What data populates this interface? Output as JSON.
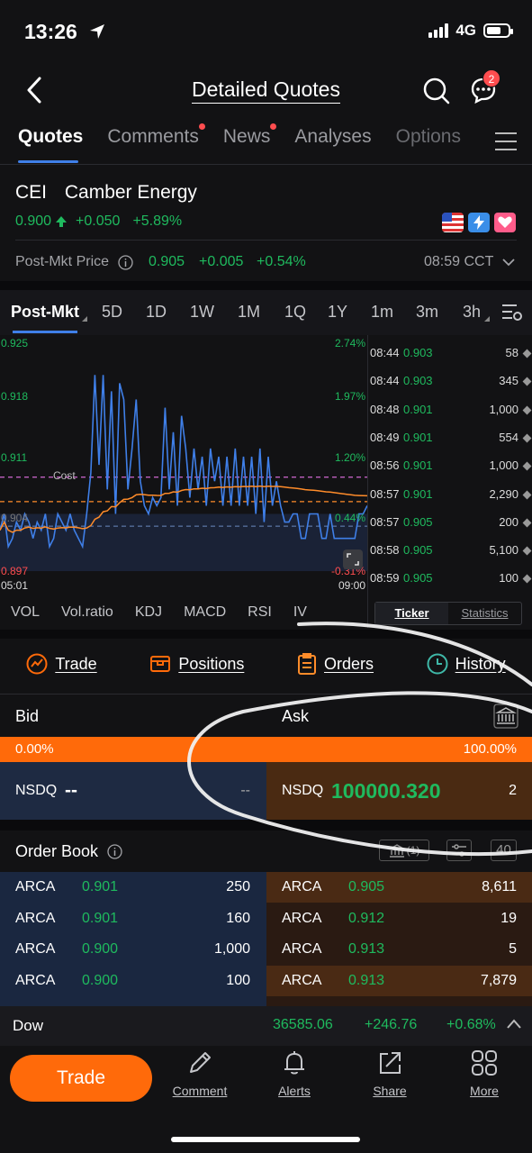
{
  "status_bar": {
    "time": "13:26",
    "network": "4G"
  },
  "header": {
    "title": "Detailed Quotes",
    "badge_count": "2"
  },
  "tabs": [
    {
      "label": "Quotes",
      "active": true,
      "dot": false
    },
    {
      "label": "Comments",
      "active": false,
      "dot": true
    },
    {
      "label": "News",
      "active": false,
      "dot": true
    },
    {
      "label": "Analyses",
      "active": false,
      "dot": false
    },
    {
      "label": "Options",
      "active": false,
      "dot": false
    }
  ],
  "stock": {
    "symbol": "CEI",
    "name": "Camber Energy",
    "price": "0.900",
    "change": "+0.050",
    "change_pct": "+5.89%"
  },
  "post_market": {
    "label": "Post-Mkt Price",
    "price": "0.905",
    "change": "+0.005",
    "change_pct": "+0.54%",
    "time": "08:59 CCT"
  },
  "range_tabs": [
    "Post-Mkt",
    "5D",
    "1D",
    "1W",
    "1M",
    "1Q",
    "1Y",
    "1m",
    "3m",
    "3h"
  ],
  "chart": {
    "y_left": [
      "0.925",
      "0.918",
      "0.911",
      "0.904",
      "0.897"
    ],
    "y_right": [
      "2.74%",
      "1.97%",
      "1.20%",
      "0.44%",
      "-0.31%"
    ],
    "x_start": "05:01",
    "x_end": "09:00",
    "cost_label": "Cost"
  },
  "chart_data": {
    "type": "line",
    "ylim": [
      0.897,
      0.925
    ],
    "xlim": [
      "05:01",
      "09:00"
    ],
    "series": [
      {
        "values": [
          0.902,
          0.904,
          0.9,
          0.901,
          0.903,
          0.902,
          0.904,
          0.903,
          0.901,
          0.903,
          0.902,
          0.904,
          0.9,
          0.901,
          0.904,
          0.903,
          0.902,
          0.904,
          0.902,
          0.901,
          0.9,
          0.904,
          0.909,
          0.921,
          0.91,
          0.921,
          0.907,
          0.919,
          0.904,
          0.92,
          0.918,
          0.907,
          0.912,
          0.918,
          0.908,
          0.905,
          0.904,
          0.906,
          0.905,
          0.906,
          0.917,
          0.907,
          0.914,
          0.905,
          0.916,
          0.912,
          0.906,
          0.912,
          0.907,
          0.911,
          0.905,
          0.912,
          0.908,
          0.911,
          0.905,
          0.911,
          0.905,
          0.912,
          0.905,
          0.911,
          0.905,
          0.911,
          0.904,
          0.912,
          0.903,
          0.911,
          0.905,
          0.908,
          0.905,
          0.903,
          0.903,
          0.904,
          0.904,
          0.901,
          0.901,
          0.904,
          0.904,
          0.904,
          0.901,
          0.901,
          0.904,
          0.901,
          0.901,
          0.901,
          0.901,
          0.901,
          0.901,
          0.904,
          0.904,
          0.905
        ]
      }
    ]
  },
  "ticker": [
    {
      "time": "08:44",
      "price": "0.903",
      "vol": "58"
    },
    {
      "time": "08:44",
      "price": "0.903",
      "vol": "345"
    },
    {
      "time": "08:48",
      "price": "0.901",
      "vol": "1,000"
    },
    {
      "time": "08:49",
      "price": "0.901",
      "vol": "554"
    },
    {
      "time": "08:56",
      "price": "0.901",
      "vol": "1,000"
    },
    {
      "time": "08:57",
      "price": "0.901",
      "vol": "2,290"
    },
    {
      "time": "08:57",
      "price": "0.905",
      "vol": "200"
    },
    {
      "time": "08:58",
      "price": "0.905",
      "vol": "5,100"
    },
    {
      "time": "08:59",
      "price": "0.905",
      "vol": "100"
    }
  ],
  "ticker_tabs": [
    "Ticker",
    "Statistics"
  ],
  "indicator_tabs": [
    "VOL",
    "Vol.ratio",
    "KDJ",
    "MACD",
    "RSI",
    "IV"
  ],
  "trade_row": [
    "Trade",
    "Positions",
    "Orders",
    "History"
  ],
  "bid_ask": {
    "bid_label": "Bid",
    "ask_label": "Ask",
    "bid_pct": "0.00%",
    "ask_pct": "100.00%",
    "bid_fraction": 0.0,
    "bid_exchange": "NSDQ",
    "bid_price": "--",
    "bid_size": "--",
    "ask_exchange": "NSDQ",
    "ask_price": "100000.320",
    "ask_size": "2"
  },
  "order_book": {
    "title": "Order Book",
    "exchange_count": "(1)",
    "depth": "40",
    "bids": [
      {
        "ex": "ARCA",
        "price": "0.901",
        "size": "250"
      },
      {
        "ex": "ARCA",
        "price": "0.901",
        "size": "160"
      },
      {
        "ex": "ARCA",
        "price": "0.900",
        "size": "1,000"
      },
      {
        "ex": "ARCA",
        "price": "0.900",
        "size": "100"
      }
    ],
    "asks": [
      {
        "ex": "ARCA",
        "price": "0.905",
        "size": "8,611"
      },
      {
        "ex": "ARCA",
        "price": "0.912",
        "size": "19"
      },
      {
        "ex": "ARCA",
        "price": "0.913",
        "size": "5"
      },
      {
        "ex": "ARCA",
        "price": "0.913",
        "size": "7,879"
      }
    ]
  },
  "index_bar": {
    "name": "Dow",
    "value": "36585.06",
    "change": "+246.76",
    "change_pct": "+0.68%"
  },
  "bottom_nav": {
    "trade": "Trade",
    "comment": "Comment",
    "alerts": "Alerts",
    "share": "Share",
    "more": "More"
  },
  "colors": {
    "accent": "#ff6a0a",
    "up": "#1fba5e",
    "down": "#ff4d4f",
    "line": "#3f7fe8",
    "cost": "#c060c0",
    "avg": "#ff8c2a"
  }
}
